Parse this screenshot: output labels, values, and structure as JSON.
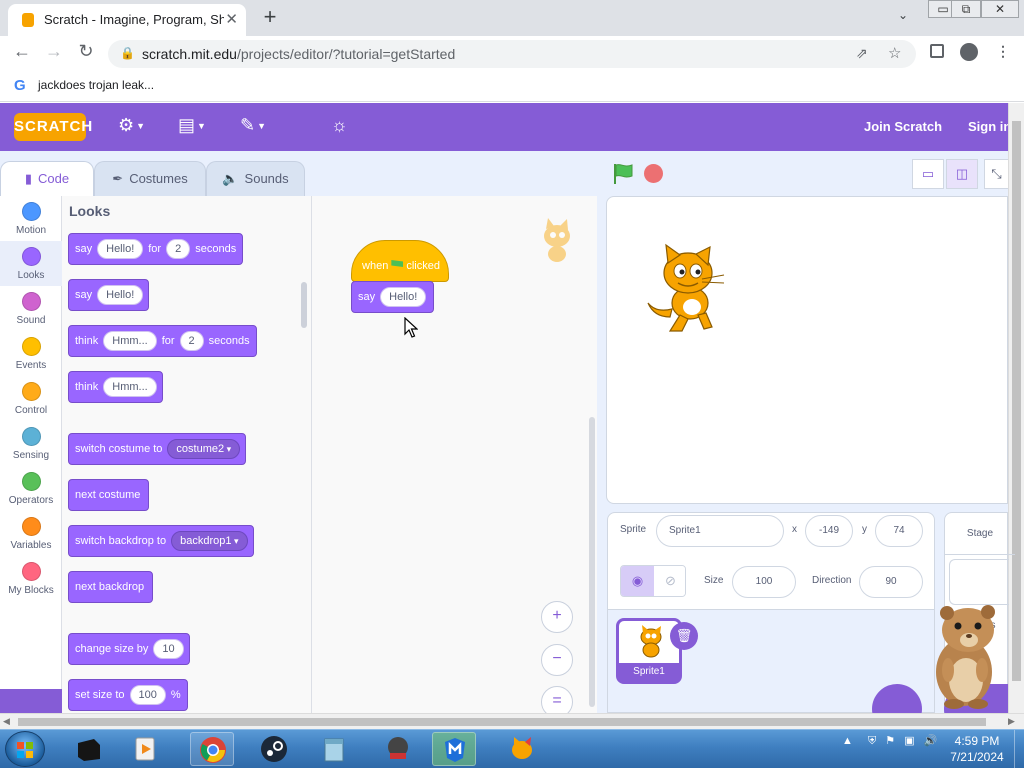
{
  "browser": {
    "tab_title": "Scratch - Imagine, Program, Share",
    "close_glyph": "✕",
    "new_tab_glyph": "+",
    "url_host": "scratch.mit.edu",
    "url_path": "/projects/editor/?tutorial=getStarted",
    "bookmark": "jackdoes trojan leak...",
    "window_buttons": [
      "▭",
      "⧉",
      "✕"
    ]
  },
  "menubar": {
    "logo": "SCRATCH",
    "join": "Join Scratch",
    "signin": "Sign in"
  },
  "tabs": [
    {
      "label": "Code"
    },
    {
      "label": "Costumes"
    },
    {
      "label": "Sounds"
    }
  ],
  "categories": [
    {
      "label": "Motion",
      "color": "#4c97ff"
    },
    {
      "label": "Looks",
      "color": "#9966ff"
    },
    {
      "label": "Sound",
      "color": "#cf63cf"
    },
    {
      "label": "Events",
      "color": "#ffbf00"
    },
    {
      "label": "Control",
      "color": "#ffab19"
    },
    {
      "label": "Sensing",
      "color": "#5cb1d6"
    },
    {
      "label": "Operators",
      "color": "#59c059"
    },
    {
      "label": "Variables",
      "color": "#ff8c1a"
    },
    {
      "label": "My Blocks",
      "color": "#ff6680"
    }
  ],
  "palette": {
    "heading": "Looks",
    "blocks": {
      "say_for": {
        "say": "say",
        "msg": "Hello!",
        "for": "for",
        "secs": "2",
        "unit": "seconds"
      },
      "say": {
        "say": "say",
        "msg": "Hello!"
      },
      "think_for": {
        "think": "think",
        "msg": "Hmm...",
        "for": "for",
        "secs": "2",
        "unit": "seconds"
      },
      "think": {
        "think": "think",
        "msg": "Hmm..."
      },
      "switch_costume": {
        "label": "switch costume to",
        "value": "costume2"
      },
      "next_costume": {
        "label": "next costume"
      },
      "switch_backdrop": {
        "label": "switch backdrop to",
        "value": "backdrop1"
      },
      "next_backdrop": {
        "label": "next backdrop"
      },
      "change_size": {
        "label": "change size by",
        "value": "10"
      },
      "set_size": {
        "label": "set size to",
        "value": "100",
        "unit": "%"
      }
    }
  },
  "script": {
    "hat_when": "when",
    "hat_clicked": "clicked",
    "say": "say",
    "say_msg": "Hello!"
  },
  "zoom": {
    "in": "+",
    "out": "−",
    "reset": "="
  },
  "sprite_info": {
    "sprite_label": "Sprite",
    "sprite_name": "Sprite1",
    "x_label": "x",
    "x_value": "-149",
    "y_label": "y",
    "y_value": "74",
    "show_label": "Show",
    "size_label": "Size",
    "size_value": "100",
    "direction_label": "Direction",
    "direction_value": "90"
  },
  "sprite_list": {
    "thumb_name": "Sprite1"
  },
  "stage_pane": {
    "label": "Stage",
    "backdrops_label": "ps"
  },
  "taskbar": {
    "time": "4:59 PM",
    "date": "7/21/2024"
  }
}
